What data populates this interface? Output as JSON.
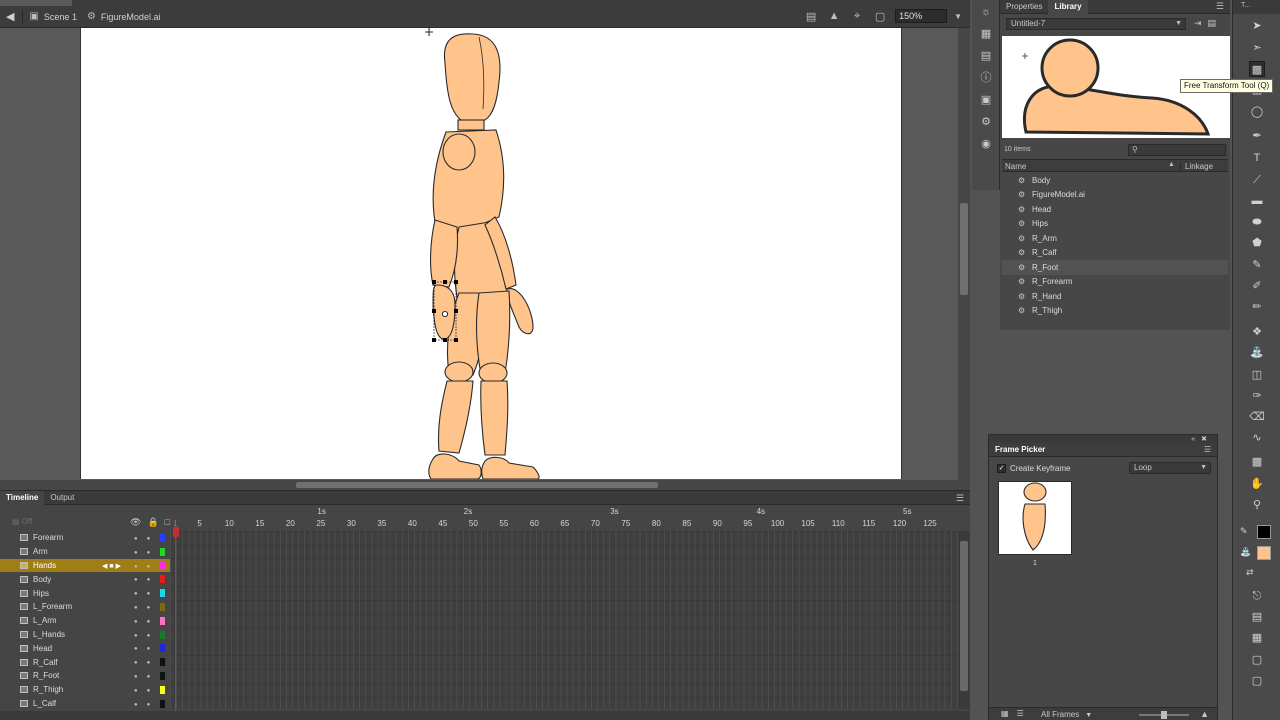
{
  "document": {
    "tab_label": "Untitled-7"
  },
  "edit_bar": {
    "scene_label": "Scene 1",
    "symbol_label": "FigureModel.ai",
    "zoom": "150%"
  },
  "timeline": {
    "tabs": [
      "Timeline",
      "Output"
    ],
    "onion_off": "Off",
    "seconds": [
      "1s",
      "2s",
      "3s",
      "4s",
      "5s"
    ],
    "frame_numbers": [
      1,
      5,
      10,
      15,
      20,
      25,
      30,
      35,
      40,
      45,
      50,
      55,
      60,
      65,
      70,
      75,
      80,
      85,
      90,
      95,
      100,
      105,
      110,
      115,
      120,
      125
    ],
    "layers": [
      {
        "name": "Forearm",
        "color": "#2a3cff",
        "selected": false
      },
      {
        "name": "Arm",
        "color": "#22d822",
        "selected": false
      },
      {
        "name": "Hands",
        "color": "#ff2de0",
        "selected": true
      },
      {
        "name": "Body",
        "color": "#e81a1a",
        "selected": false
      },
      {
        "name": "Hips",
        "color": "#1ad8e8",
        "selected": false
      },
      {
        "name": "L_Forearm",
        "color": "#7a6a10",
        "selected": false
      },
      {
        "name": "L_Arm",
        "color": "#ff70c0",
        "selected": false
      },
      {
        "name": "L_Hands",
        "color": "#1a7a2a",
        "selected": false
      },
      {
        "name": "Head",
        "color": "#1a2ad8",
        "selected": false
      },
      {
        "name": "R_Calf",
        "color": "#111111",
        "selected": false
      },
      {
        "name": "R_Foot",
        "color": "#111111",
        "selected": false
      },
      {
        "name": "R_Thigh",
        "color": "#ffff20",
        "selected": false
      },
      {
        "name": "L_Calf",
        "color": "#111111",
        "selected": false
      }
    ]
  },
  "library": {
    "tabs": [
      "Properties",
      "Library"
    ],
    "document_select": "Untitled-7",
    "item_count": "10 items",
    "columns": {
      "name": "Name",
      "linkage": "Linkage"
    },
    "items": [
      {
        "name": "Body",
        "highlighted": false
      },
      {
        "name": "FigureModel.ai",
        "highlighted": false
      },
      {
        "name": "Head",
        "highlighted": false
      },
      {
        "name": "Hips",
        "highlighted": false
      },
      {
        "name": "R_Arm",
        "highlighted": false
      },
      {
        "name": "R_Calf",
        "highlighted": false
      },
      {
        "name": "R_Foot",
        "highlighted": true
      },
      {
        "name": "R_Forearm",
        "highlighted": false
      },
      {
        "name": "R_Hand",
        "highlighted": false
      },
      {
        "name": "R_Thigh",
        "highlighted": false
      }
    ]
  },
  "tools": {
    "panel_label": "T...",
    "tooltip": "Free Transform Tool (Q)",
    "stroke_color": "#000000",
    "fill_color": "#ffc48c"
  },
  "frame_picker": {
    "title": "Frame Picker",
    "create_keyframe": "Create Keyframe",
    "create_keyframe_checked": true,
    "loop": "Loop",
    "thumb_label": "1",
    "all_frames": "All Frames"
  },
  "figure": {
    "fill": "#ffc48c",
    "stroke": "#2a2a2a"
  }
}
